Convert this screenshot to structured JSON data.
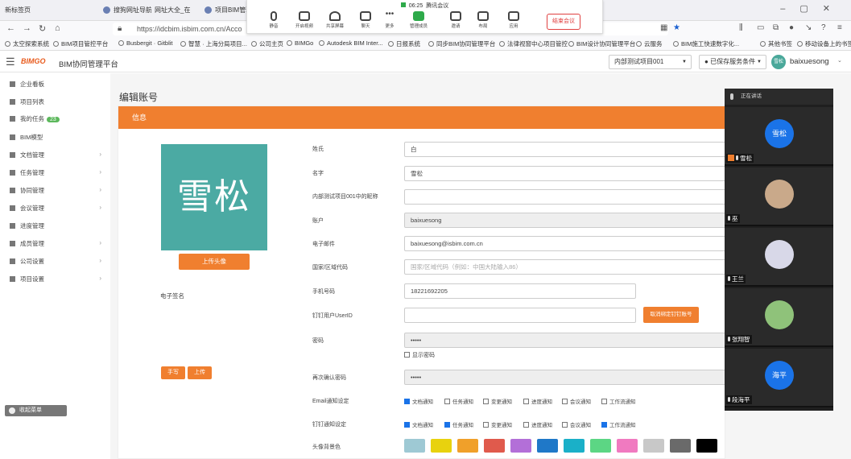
{
  "browser": {
    "tabs": [
      {
        "label": "新标签页"
      },
      {
        "label": "搜狗网址导航"
      },
      {
        "label": "网址大全_在"
      },
      {
        "label": "项目BIM管理"
      }
    ],
    "url": "https://idcbim.isbim.com.cn/Acco",
    "bookmarks": [
      "太空探索系统",
      "BIM项目管控平台",
      "Busbergit · Gitblit",
      "智慧 · 上海分局项目...",
      "公司主页",
      "BIMGo",
      "Autodesk BIM Inter...",
      "日报系统",
      "同步BIM协同管理平台",
      "法律视窗中心项目管控",
      "BIM设计协同管理平台",
      "云服务",
      "BIM施工快速数字化...",
      "其他书签",
      "移动设备上的书签"
    ]
  },
  "meeting": {
    "time": "06:25",
    "title": "腾讯会议",
    "tools": [
      "静音",
      "开启视频",
      "共享屏幕",
      "聊天",
      "更多",
      "管理成员",
      "邀请",
      "布局",
      "应用",
      "录制"
    ],
    "end_label": "结束会议"
  },
  "header": {
    "logo": "BIMGO",
    "app_title": "BIM协同管理平台",
    "project": "内部测试项目001",
    "saved_label": "已保存服务条件",
    "avatar_text": "雪松",
    "username": "baixuesong"
  },
  "sidebar": {
    "items": [
      {
        "label": "企业看板"
      },
      {
        "label": "项目列表"
      },
      {
        "label": "我的任务",
        "badge": "23"
      },
      {
        "label": "BIM模型"
      },
      {
        "label": "文档管理"
      },
      {
        "label": "任务管理"
      },
      {
        "label": "协同管理"
      },
      {
        "label": "会议管理"
      },
      {
        "label": "进度管理"
      },
      {
        "label": "成员管理"
      },
      {
        "label": "公司设置"
      },
      {
        "label": "项目设置"
      }
    ],
    "collapse_label": "收起菜单"
  },
  "page": {
    "title": "编辑账号",
    "panel_title": "信息",
    "avatar_text": "雪松",
    "upload_label": "上传头像",
    "signature_label": "电子签名",
    "sig_btn_1": "手写",
    "sig_btn_2": "上传"
  },
  "form": {
    "surname": {
      "label": "姓氏",
      "value": "白"
    },
    "name": {
      "label": "名字",
      "value": "雪松"
    },
    "alias": {
      "label": "内部测试项目001中的昵称",
      "value": ""
    },
    "account": {
      "label": "账户",
      "value": "baixuesong"
    },
    "email": {
      "label": "电子邮件",
      "value": "baixuesong@isbim.com.cn"
    },
    "region": {
      "label": "国家/区域代码",
      "placeholder": "国家/区域代码（例如：中国大陆输入86）"
    },
    "phone": {
      "label": "手机号码",
      "value": "18221692205"
    },
    "dingtalk": {
      "label": "钉钉用户UserID",
      "value": ""
    },
    "dingtalk_btn": "取消绑定钉钉账号",
    "password": {
      "label": "密码",
      "value": "•••••"
    },
    "show_password": "显示密码",
    "confirm": {
      "label": "再次确认密码",
      "value": "•••••"
    },
    "email_notify": {
      "label": "Email通知设定"
    },
    "dingtalk_notify": {
      "label": "钉钉通知设定"
    },
    "notify_options": [
      "文档通知",
      "任务通知",
      "变更通知",
      "进度通知",
      "会议通知",
      "工作流通知"
    ],
    "email_checked": [
      true,
      false,
      false,
      false,
      false,
      false
    ],
    "dingtalk_checked": [
      true,
      true,
      false,
      false,
      false,
      true
    ],
    "avatar_color_label": "头像背景色",
    "avatar_colors": [
      "#9ec9d4",
      "#e8d20e",
      "#f0a02a",
      "#e05a4c",
      "#b36fd8",
      "#1f78c8",
      "#1ab0c8",
      "#5cd684",
      "#f07ac0",
      "#c8c8c8",
      "#6a6a6a",
      "#000000"
    ]
  },
  "video": {
    "header": "正在讲话",
    "participants": [
      {
        "name": "雪松",
        "avatar": "雪松",
        "color": "#1a73e8",
        "host": true
      },
      {
        "name": "巫",
        "avatar": "",
        "color": "#c9a98a",
        "host": false
      },
      {
        "name": "王兰",
        "avatar": "",
        "color": "#d8d8e8",
        "host": false
      },
      {
        "name": "张翔智",
        "avatar": "",
        "color": "#8fc27a",
        "host": false
      },
      {
        "name": "段海平",
        "avatar": "海平",
        "color": "#1a73e8",
        "host": false
      }
    ]
  }
}
